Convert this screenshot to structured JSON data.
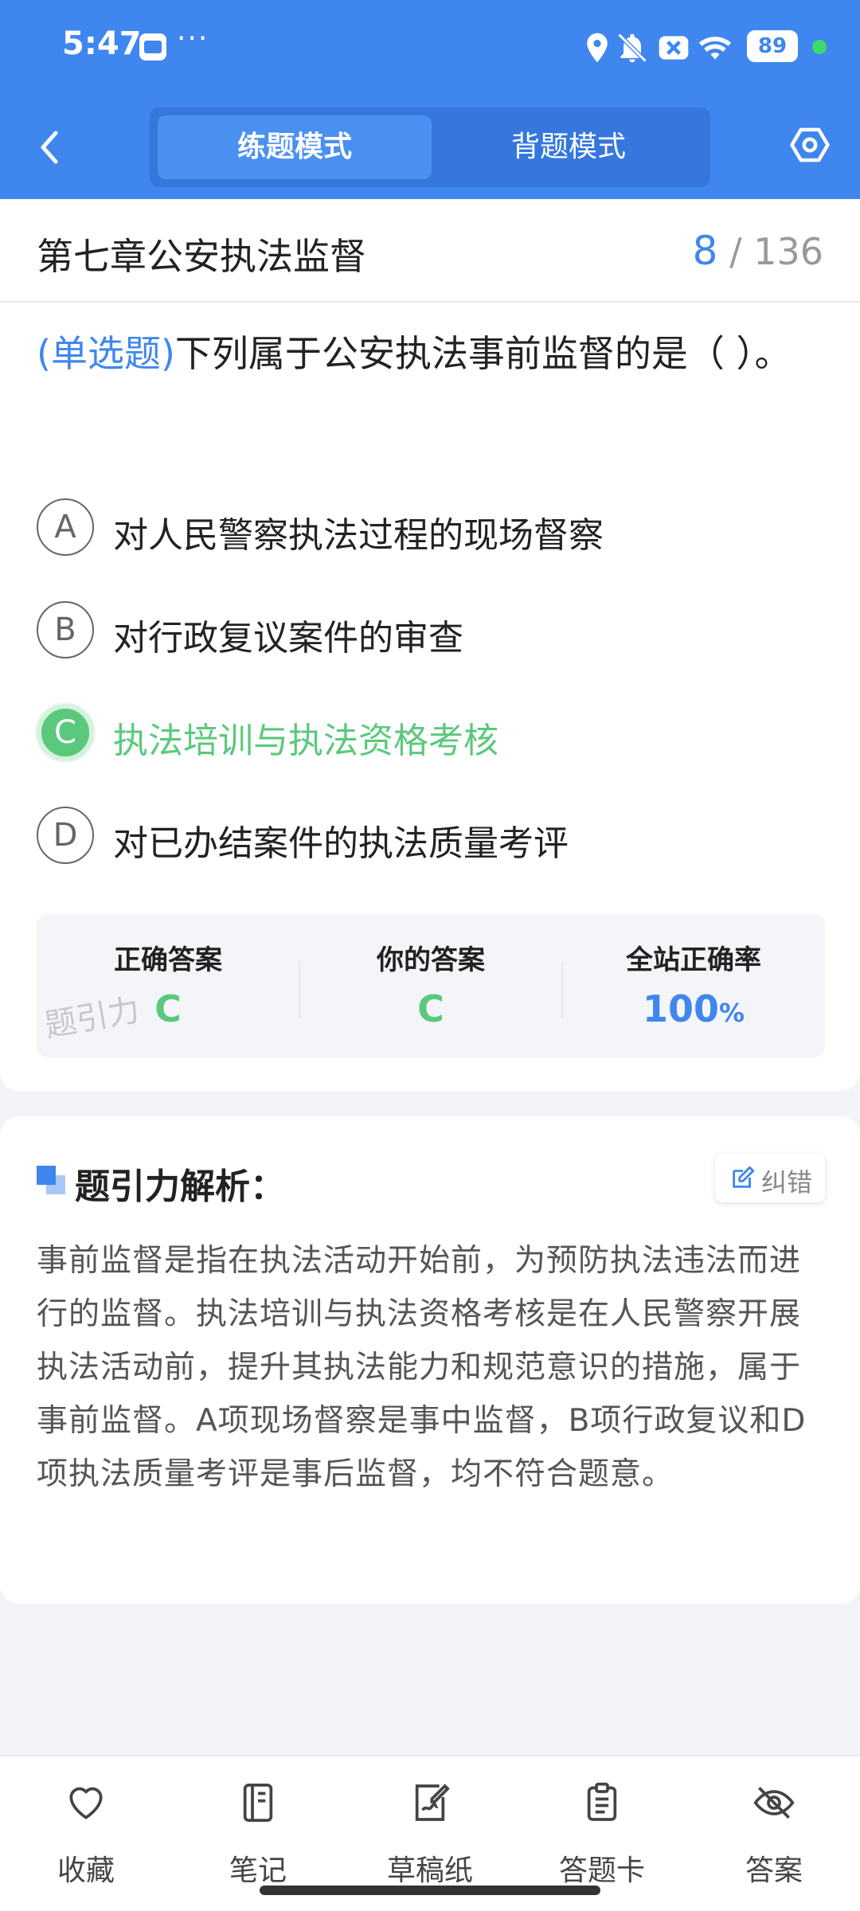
{
  "status_bar": {
    "time": "5:47",
    "more": "···",
    "battery": "89",
    "icons": [
      "app-wallet-icon",
      "location-icon",
      "mute-bell-icon",
      "close-box-icon",
      "wifi-icon",
      "battery-icon"
    ]
  },
  "header": {
    "modes": [
      {
        "label": "练题模式",
        "active": true
      },
      {
        "label": "背题模式",
        "active": false
      }
    ],
    "back_icon": "chevron-left-icon",
    "settings_icon": "settings-icon"
  },
  "chapter": {
    "title": "第七章公安执法监督",
    "current": "8",
    "total": "/ 136"
  },
  "question": {
    "type": "(单选题)",
    "text": "下列属于公安执法事前监督的是（    ）。",
    "options": [
      {
        "letter": "A",
        "text": "对人民警察执法过程的现场督察",
        "state": "normal"
      },
      {
        "letter": "B",
        "text": "对行政复议案件的审查",
        "state": "normal"
      },
      {
        "letter": "C",
        "text": "执法培训与执法资格考核",
        "state": "correct"
      },
      {
        "letter": "D",
        "text": "对已办结案件的执法质量考评",
        "state": "normal"
      }
    ]
  },
  "answer_summary": {
    "correct_label": "正确答案",
    "correct_value": "C",
    "yours_label": "你的答案",
    "yours_value": "C",
    "rate_label": "全站正确率",
    "rate_value": "100",
    "rate_unit": "%",
    "watermark": "题引力"
  },
  "analysis": {
    "title": "题引力解析：",
    "correct_button": "纠错",
    "text": "事前监督是指在执法活动开始前，为预防执法违法而进行的监督。执法培训与执法资格考核是在人民警察开展执法活动前，提升其执法能力和规范意识的措施，属于事前监督。A项现场督察是事中监督，B项行政复议和D项执法质量考评是事后监督，均不符合题意。"
  },
  "bottom_nav": [
    {
      "label": "收藏",
      "icon": "heart-icon"
    },
    {
      "label": "笔记",
      "icon": "notebook-icon"
    },
    {
      "label": "草稿纸",
      "icon": "draft-icon"
    },
    {
      "label": "答题卡",
      "icon": "clipboard-icon"
    },
    {
      "label": "答案",
      "icon": "eye-off-icon"
    }
  ],
  "colors": {
    "primary": "#3f86ee",
    "correct": "#5bc97c"
  }
}
